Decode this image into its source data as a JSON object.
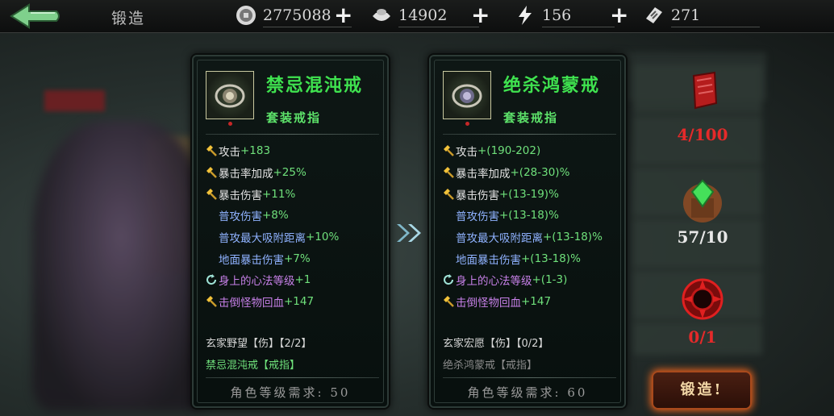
{
  "header": {
    "title": "锻造",
    "resources": [
      {
        "icon": "coin-icon",
        "value": "2775088"
      },
      {
        "icon": "ingot-icon",
        "value": "14902"
      },
      {
        "icon": "lightning-icon",
        "value": "156"
      },
      {
        "icon": "ticket-icon",
        "value": "271"
      }
    ],
    "plus": "+"
  },
  "current_item": {
    "name": "禁忌混沌戒",
    "type": "套装戒指",
    "stats": [
      {
        "icon": "hammer-icon",
        "label": "攻击",
        "value": "+183",
        "color": "n"
      },
      {
        "icon": "hammer-icon",
        "label": "暴击率加成",
        "value": "+25%",
        "color": "n"
      },
      {
        "icon": "hammer-icon",
        "label": "暴击伤害",
        "value": "+11%",
        "color": "n"
      },
      {
        "icon": "",
        "label": "普攻伤害",
        "value": "+8%",
        "color": "b"
      },
      {
        "icon": "",
        "label": "普攻最大吸附距离",
        "value": "+10%",
        "color": "b"
      },
      {
        "icon": "",
        "label": "地面暴击伤害",
        "value": "+7%",
        "color": "b"
      },
      {
        "icon": "cycle-icon",
        "label": "身上的心法等级",
        "value": "+1",
        "color": "p"
      },
      {
        "icon": "hammer-icon",
        "label": "击倒怪物回血",
        "value": "+147",
        "color": "p"
      }
    ],
    "set_name": "玄家野望【伤】【2/2】",
    "set_piece": "禁忌混沌戒【戒指】",
    "requirement": "角色等级需求: 50"
  },
  "next_item": {
    "name": "绝杀鸿蒙戒",
    "type": "套装戒指",
    "stats": [
      {
        "icon": "hammer-icon",
        "label": "攻击",
        "value": "+(190-202)",
        "color": "n"
      },
      {
        "icon": "hammer-icon",
        "label": "暴击率加成",
        "value": "+(28-30)%",
        "color": "n"
      },
      {
        "icon": "hammer-icon",
        "label": "暴击伤害",
        "value": "+(13-19)%",
        "color": "n"
      },
      {
        "icon": "",
        "label": "普攻伤害",
        "value": "+(13-18)%",
        "color": "b"
      },
      {
        "icon": "",
        "label": "普攻最大吸附距离",
        "value": "+(13-18)%",
        "color": "b"
      },
      {
        "icon": "",
        "label": "地面暴击伤害",
        "value": "+(13-18)%",
        "color": "b"
      },
      {
        "icon": "cycle-icon",
        "label": "身上的心法等级",
        "value": "+(1-3)",
        "color": "p"
      },
      {
        "icon": "hammer-icon",
        "label": "击倒怪物回血",
        "value": "+147",
        "color": "p"
      }
    ],
    "set_name": "玄家宏愿【伤】【0/2】",
    "set_piece": "绝杀鸿蒙戒【戒指】",
    "requirement": "角色等级需求: 60"
  },
  "materials": [
    {
      "icon": "red-scroll-icon",
      "count": "4/100",
      "color": "#e52a2a"
    },
    {
      "icon": "green-gem-icon",
      "count": "57/10",
      "color": "#e8e8e8"
    },
    {
      "icon": "red-rune-icon",
      "count": "0/1",
      "color": "#e52a2a"
    }
  ],
  "forge_button": "锻造!",
  "colors": {
    "green": "#3fe24f",
    "blue": "#8fb2ff",
    "purple": "#c780e8",
    "red": "#e52a2a",
    "accent": "#ff6a1c"
  }
}
